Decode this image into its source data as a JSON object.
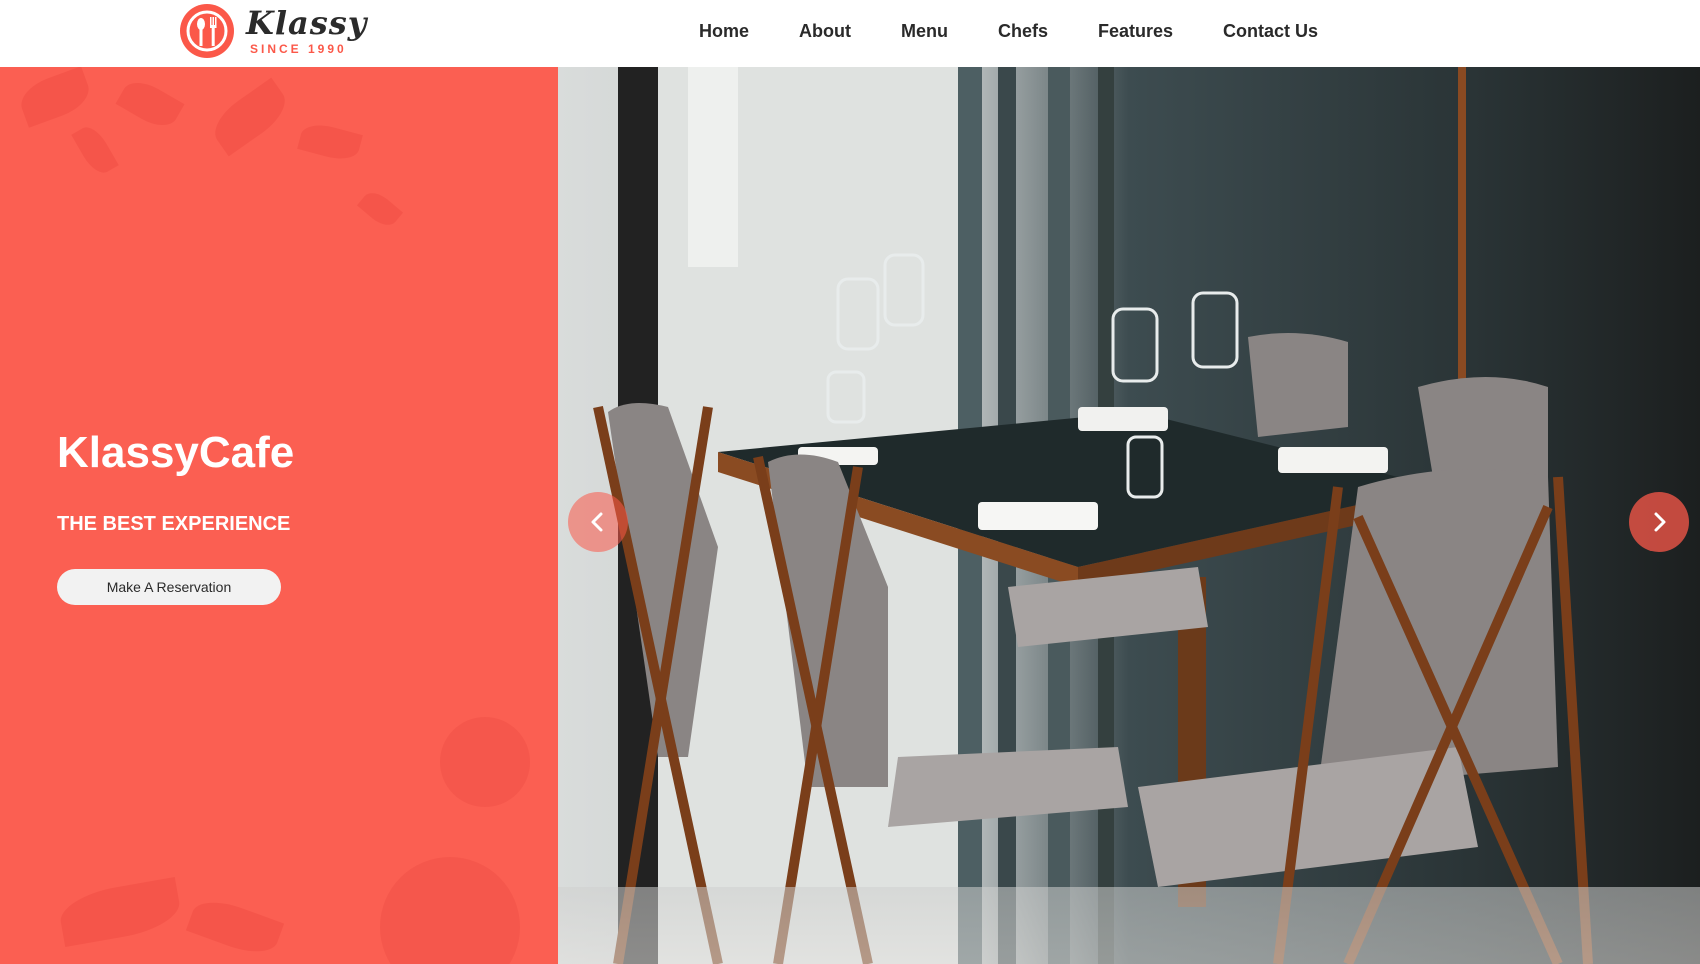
{
  "brand": {
    "name": "Klassy",
    "tagline": "SINCE 1990",
    "accent_color": "#fb5849"
  },
  "nav": {
    "items": [
      {
        "label": "Home"
      },
      {
        "label": "About"
      },
      {
        "label": "Menu"
      },
      {
        "label": "Chefs"
      },
      {
        "label": "Features"
      },
      {
        "label": "Contact Us"
      }
    ]
  },
  "hero": {
    "title": "KlassyCafe",
    "subtitle": "THE BEST EXPERIENCE",
    "cta_label": "Make A Reservation",
    "panel_color": "#fb5f52",
    "prev_icon": "chevron-left-icon",
    "next_icon": "chevron-right-icon"
  }
}
